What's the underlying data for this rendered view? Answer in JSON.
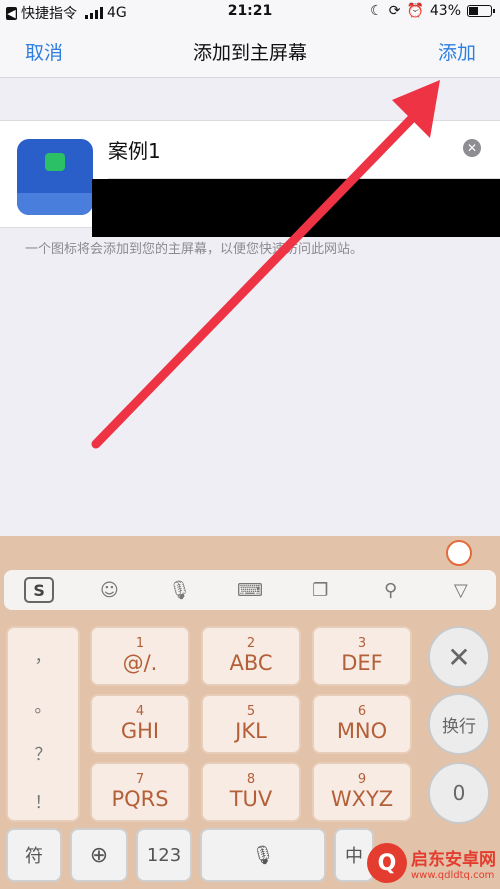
{
  "status_bar": {
    "back_app": "快捷指令",
    "network": "4G",
    "time": "21:21",
    "battery": "43%",
    "battery_level": 0.43
  },
  "nav": {
    "cancel_label": "取消",
    "title": "添加到主屏幕",
    "add_label": "添加"
  },
  "form": {
    "name_value": "案例1",
    "hint": "一个图标将会添加到您的主屏幕，以便您快速访问此网站。"
  },
  "keyboard": {
    "keys": [
      {
        "num": "1",
        "letters": "@/."
      },
      {
        "num": "2",
        "letters": "ABC"
      },
      {
        "num": "3",
        "letters": "DEF"
      },
      {
        "num": "4",
        "letters": "GHI"
      },
      {
        "num": "5",
        "letters": "JKL"
      },
      {
        "num": "6",
        "letters": "MNO"
      },
      {
        "num": "7",
        "letters": "PQRS"
      },
      {
        "num": "8",
        "letters": "TUV"
      },
      {
        "num": "9",
        "letters": "WXYZ"
      }
    ],
    "punctuation": [
      "，",
      "。",
      "？",
      "！"
    ],
    "delete_label": "✕",
    "newline_label": "换行",
    "zero_label": "0",
    "symbol_label": "符",
    "num_label": "123",
    "cn_label": "中",
    "toolbar_logo": "S"
  },
  "watermark": {
    "name": "启东安卓网",
    "url": "www.qdldtq.com",
    "logo": "Q"
  },
  "colors": {
    "accent": "#2f7fe0",
    "keyboard_bg": "#e2c2a8",
    "key_text": "#b35f38",
    "arrow": "#ee3344"
  }
}
